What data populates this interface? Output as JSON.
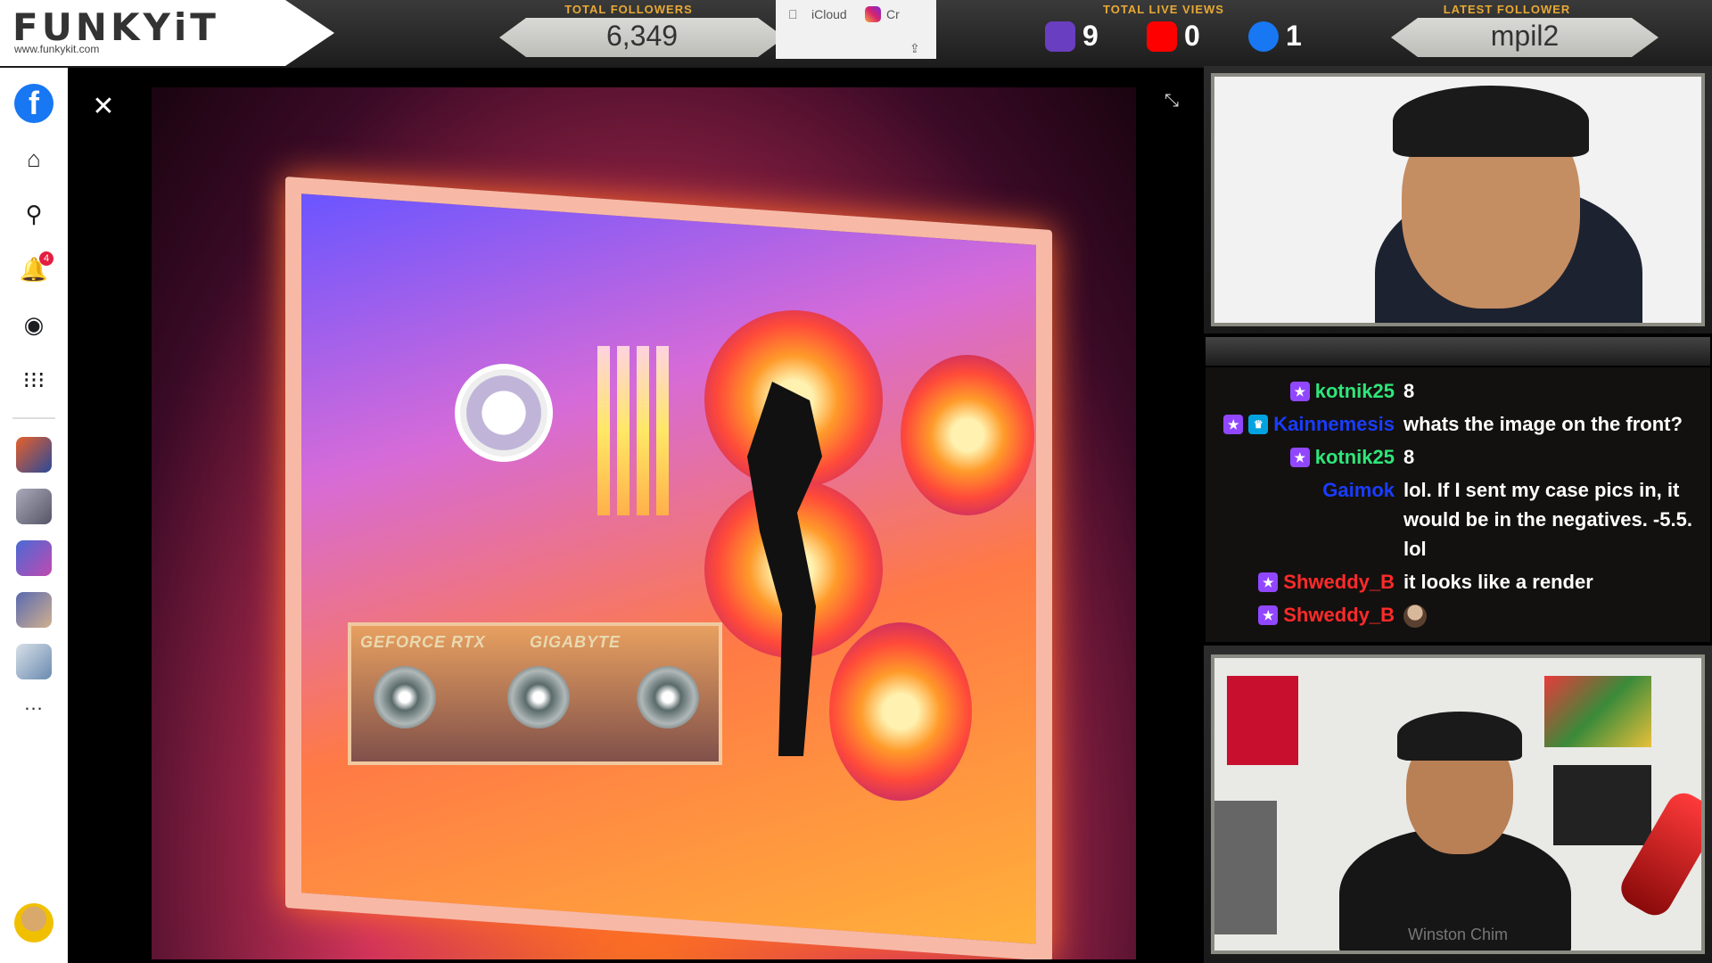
{
  "brand": {
    "logo": "FUNKYiT",
    "url": "www.funkykit.com"
  },
  "stats": {
    "followers_label": "TOTAL FOLLOWERS",
    "followers_value": "6,349",
    "live_label": "TOTAL LIVE VIEWS",
    "twitch_views": "9",
    "youtube_views": "0",
    "facebook_views": "1",
    "latest_label": "LATEST FOLLOWER",
    "latest_value": "mpil2"
  },
  "browser_tabs": {
    "tab1": "iCloud",
    "tab2": "Cr"
  },
  "rail": {
    "notification_count": "4",
    "more": "..."
  },
  "viewer": {
    "close": "✕",
    "collapse": "⤡",
    "gpu_label_left": "GEFORCE RTX",
    "gpu_label_right": "GIGABYTE"
  },
  "chat": [
    {
      "name": "kotnik25",
      "name_color": "#2ee67a",
      "badges": [
        "star"
      ],
      "msg": "8"
    },
    {
      "name": "Kainnemesis",
      "name_color": "#1a3cff",
      "badges": [
        "star",
        "crown"
      ],
      "msg": "whats the image on the front?"
    },
    {
      "name": "kotnik25",
      "name_color": "#2ee67a",
      "badges": [
        "star"
      ],
      "msg": "8"
    },
    {
      "name": "Gaimok",
      "name_color": "#1a3cff",
      "badges": [],
      "msg": "lol. If I sent my case pics in, it would be in the negatives. -5.5. lol"
    },
    {
      "name": "Shweddy_B",
      "name_color": "#ff2a2a",
      "badges": [
        "star"
      ],
      "msg": "it looks like a render"
    },
    {
      "name": "Shweddy_B",
      "name_color": "#ff2a2a",
      "badges": [
        "star"
      ],
      "msg": ""
    }
  ],
  "webcam": {
    "name": "Winston Chim"
  },
  "colors": {
    "accent": "#e8a935",
    "facebook": "#1877f2",
    "youtube": "#ff0000",
    "twitch": "#9147ff"
  }
}
